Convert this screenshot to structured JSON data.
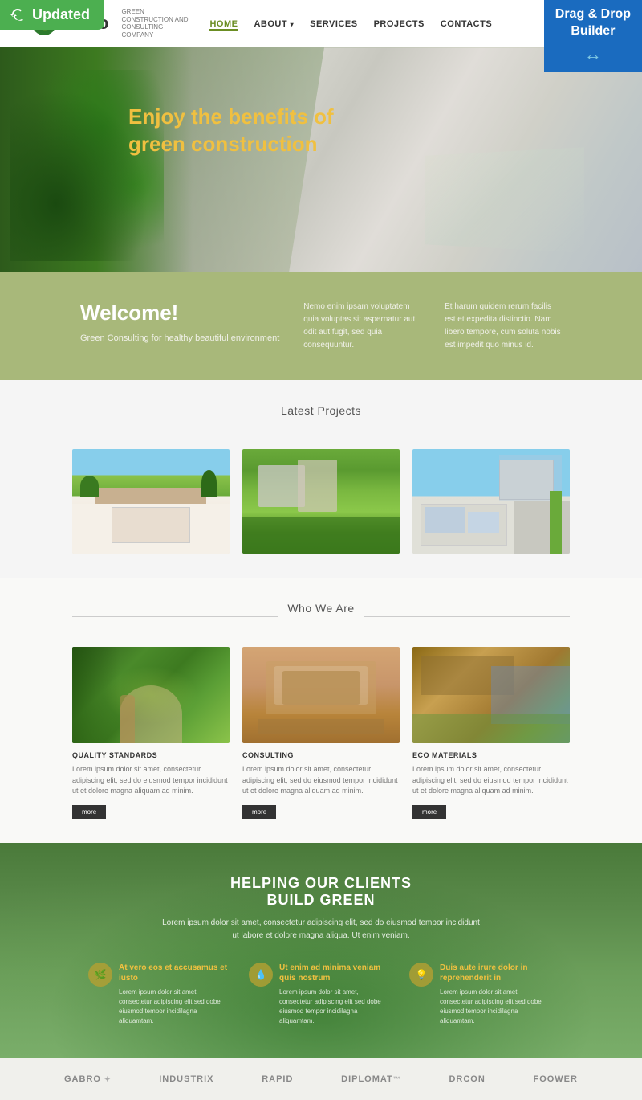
{
  "badges": {
    "updated_label": "Updated",
    "dnd_line1": "Drag & Drop",
    "dnd_line2": "Builder"
  },
  "header": {
    "logo_text": "Gobo",
    "tagline": "GREEN CONSTRUCTION AND CONSULTING COMPANY",
    "nav": [
      {
        "label": "HOME",
        "active": true
      },
      {
        "label": "ABOUT",
        "active": false
      },
      {
        "label": "SERVICES",
        "active": false
      },
      {
        "label": "PROJECTS",
        "active": false
      },
      {
        "label": "CONTACTS",
        "active": false
      }
    ]
  },
  "hero": {
    "title": "Enjoy the benefits of green construction",
    "prev_label": "‹",
    "next_label": "›"
  },
  "welcome": {
    "title": "Welcome!",
    "subtitle": "Green Consulting for healthy beautiful environment",
    "text1": "Nemo enim ipsam voluptatem quia voluptas sit aspernatur aut odit aut fugit, sed quia consequuntur.",
    "text2": "Et harum quidem rerum facilis est et expedita distinctio. Nam libero tempore, cum soluta nobis est impedit quo minus id."
  },
  "latest_projects": {
    "title": "Latest Projects"
  },
  "who_we_are": {
    "title": "Who We Are",
    "cards": [
      {
        "label": "QUALITY STANDARDS",
        "text": "Lorem ipsum dolor sit amet, consectetur adipiscing elit, sed do eiusmod tempor incididunt ut et dolore magna aliquam ad minim.",
        "btn": "more"
      },
      {
        "label": "CONSULTING",
        "text": "Lorem ipsum dolor sit amet, consectetur adipiscing elit, sed do eiusmod tempor incididunt ut et dolore magna aliquam ad minim.",
        "btn": "more"
      },
      {
        "label": "ECO MATERIALS",
        "text": "Lorem ipsum dolor sit amet, consectetur adipiscing elit, sed do eiusmod tempor incididunt ut et dolore magna aliquam ad minim.",
        "btn": "more"
      }
    ]
  },
  "green_section": {
    "heading_line1": "HELPING OUR CLIENTS",
    "heading_line2": "BUILD GREEN",
    "subtext": "Lorem ipsum dolor sit amet, consectetur adipiscing elit, sed do eiusmod tempor incididunt ut labore et dolore magna aliqua. Ut enim veniam.",
    "cards": [
      {
        "icon": "🌿",
        "title": "At vero eos et accusamus et iusto",
        "text": "Lorem ipsum dolor sit amet, consectetur adipiscing elit sed dobe eiusmod tempor incidilagna aliquamtam."
      },
      {
        "icon": "💧",
        "title": "Ut enim ad minima veniam quis nostrum",
        "text": "Lorem ipsum dolor sit amet, consectetur adipiscing elit sed dobe eiusmod tempor incidilagna aliquamtam."
      },
      {
        "icon": "💡",
        "title": "Duis aute irure dolor in reprehenderit in",
        "text": "Lorem ipsum dolor sit amet, consectetur adipiscing elit sed dobe eiusmod tempor incidilagna aliquamtam."
      }
    ]
  },
  "partners": [
    {
      "name": "GABRO",
      "suffix": "✦"
    },
    {
      "name": "INDUSTRIX",
      "suffix": ""
    },
    {
      "name": "RAPID",
      "suffix": ""
    },
    {
      "name": "DIPLOMAT",
      "suffix": "™"
    },
    {
      "name": "dRCON",
      "suffix": ""
    },
    {
      "name": "FOOWER",
      "suffix": ""
    }
  ]
}
